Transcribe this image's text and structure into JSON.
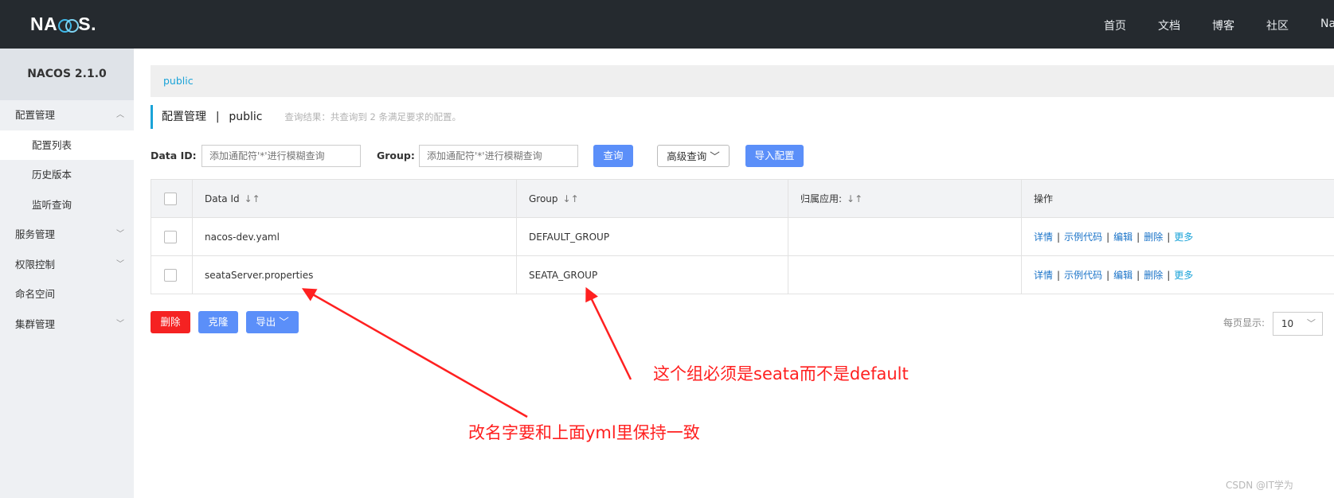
{
  "header": {
    "logo": "NACOS.",
    "nav": [
      "首页",
      "文档",
      "博客",
      "社区",
      "Na"
    ]
  },
  "sidebar": {
    "version": "NACOS 2.1.0",
    "items": [
      {
        "label": "配置管理",
        "expanded": true
      },
      {
        "label": "配置列表",
        "sub": true,
        "active": true
      },
      {
        "label": "历史版本",
        "sub": true
      },
      {
        "label": "监听查询",
        "sub": true
      },
      {
        "label": "服务管理"
      },
      {
        "label": "权限控制"
      },
      {
        "label": "命名空间"
      },
      {
        "label": "集群管理"
      }
    ]
  },
  "breadcrumb": "public",
  "page": {
    "title": "配置管理",
    "separator": "|",
    "namespace": "public",
    "hint": "查询结果：共查询到 2 条满足要求的配置。"
  },
  "filter": {
    "data_id_label": "Data ID:",
    "data_id_placeholder": "添加通配符'*'进行模糊查询",
    "group_label": "Group:",
    "group_placeholder": "添加通配符'*'进行模糊查询",
    "query_button": "查询",
    "advanced_button": "高级查询",
    "import_button": "导入配置"
  },
  "table": {
    "headers": [
      "Data Id",
      "Group",
      "归属应用:",
      "操作"
    ],
    "rows": [
      {
        "data_id": "nacos-dev.yaml",
        "group": "DEFAULT_GROUP",
        "app": ""
      },
      {
        "data_id": "seataServer.properties",
        "group": "SEATA_GROUP",
        "app": ""
      }
    ],
    "actions": [
      "详情",
      "示例代码",
      "编辑",
      "删除",
      "更多"
    ]
  },
  "bulk": {
    "delete": "删除",
    "clone": "克隆",
    "export": "导出"
  },
  "pagination": {
    "label": "每页显示:",
    "page_size": "10"
  },
  "annotations": {
    "group_note": "这个组必须是seata而不是default",
    "name_note": "改名字要和上面yml里保持一致"
  },
  "watermark": "CSDN @IT学为",
  "colors": {
    "topbar": "#252a2f",
    "accent": "#1aa3d8",
    "primary": "#5b8ff9",
    "danger": "#f52222",
    "annotation": "#ff2020"
  }
}
